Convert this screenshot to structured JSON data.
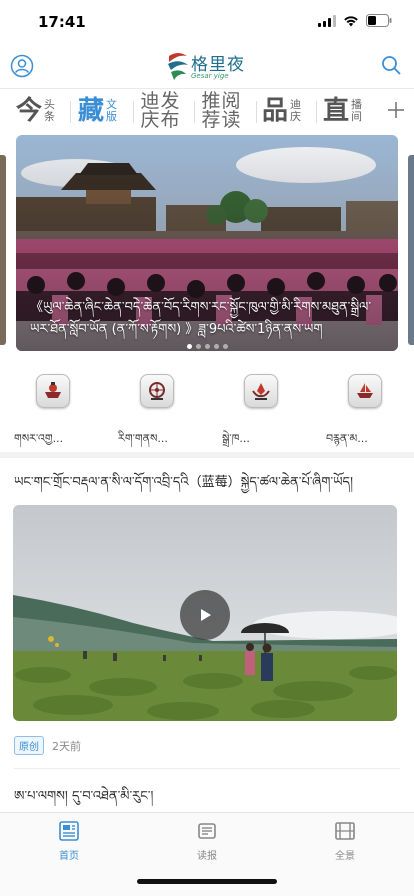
{
  "status_bar": {
    "time": "17:41"
  },
  "header": {
    "logo_text": "格里夜",
    "logo_subtitle": "Gesar yige"
  },
  "tabs": [
    {
      "big": "今",
      "small": "头条",
      "active": false
    },
    {
      "big": "藏",
      "small": "文版",
      "active": true
    },
    {
      "duo_a": "迪庆",
      "duo_b": "发布",
      "active": false
    },
    {
      "duo_a": "推荐",
      "duo_b": "阅读",
      "active": false
    },
    {
      "big": "品",
      "small": "迪庆",
      "active": false
    },
    {
      "big": "直",
      "small": "播间",
      "active": false
    }
  ],
  "hero": {
    "caption": "《ཡུལ་ཆེན་ཞིང་ཆེན་བདེ་ཆེན་བོད་རིགས་རང་སྐྱོང་ཁུལ་གྱི་མི་རིགས་མཐུན་སྒྲིལ་ཡར་ཐོན་སློབ་ཡོན (ན་ཀོ་ས་རྟོགས) 》ཟླ་9པའི་ཚེས་1ཉིན་ནས་ཡག",
    "slide_count": 5,
    "active_slide": 1
  },
  "quick_links": [
    {
      "label": "གསར་འགྱ..."
    },
    {
      "label": "རིག་གནས..."
    },
    {
      "label": "སྒྲེ་ཁ..."
    },
    {
      "label": "བརྙན་མ..."
    }
  ],
  "article1": {
    "title": "ཡང་གང་གྲོང་བརྡལ་ན་སི་ལ་དོག་འབྲི་དའི（蓝莓）སྐྱེད་ཚལ་ཆེན་པོ་ཞིག་ཡོད།",
    "badge": "原创",
    "time": "2天前"
  },
  "article2": {
    "title": "ཨ་པ་ལགས། དུ་བ་འཐེན་མི་རུང་།"
  },
  "bottom_nav": [
    {
      "label": "首页",
      "active": true
    },
    {
      "label": "读报",
      "active": false
    },
    {
      "label": "全景",
      "active": false
    }
  ],
  "colors": {
    "accent": "#3a8ed6",
    "tab_inactive": "#555555"
  }
}
